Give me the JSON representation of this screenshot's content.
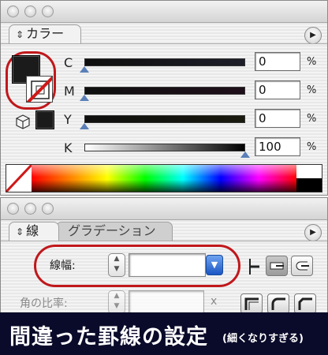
{
  "color_panel": {
    "tab_label": "カラー",
    "sliders": [
      {
        "label": "C",
        "value": "0",
        "unit": "%",
        "gradient": [
          "#0f0f0f",
          "#1e1e2a"
        ],
        "pos": 0.0
      },
      {
        "label": "M",
        "value": "0",
        "unit": "%",
        "gradient": [
          "#0f0f0f",
          "#1f0f1a"
        ],
        "pos": 0.0
      },
      {
        "label": "Y",
        "value": "0",
        "unit": "%",
        "gradient": [
          "#0f0f0f",
          "#1a1a0f"
        ],
        "pos": 0.0
      },
      {
        "label": "K",
        "value": "100",
        "unit": "%",
        "gradient": [
          "#ffffff",
          "#000000"
        ],
        "pos": 1.0
      }
    ],
    "fill_color": "#1c1b1c",
    "stroke_color": "none",
    "highlight_color": "#c0181b"
  },
  "stroke_panel": {
    "tab_active": "線",
    "tab_inactive": "グラデーション",
    "weight_label": "線幅:",
    "weight_value": "",
    "miter_label": "角の比率:",
    "miter_value": "",
    "miter_unit": "x"
  },
  "caption": {
    "main": "間違った罫線の設定",
    "sub": "(細くなりすぎる)"
  }
}
